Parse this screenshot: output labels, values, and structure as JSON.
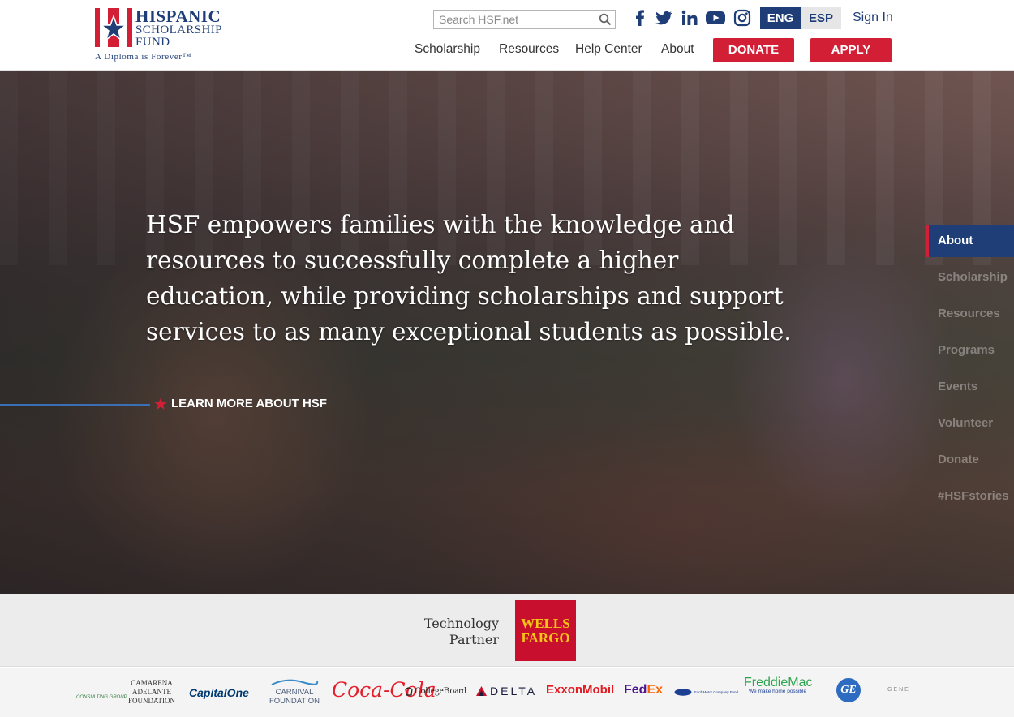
{
  "header": {
    "logo": {
      "line1": "HISPANIC",
      "line2": "SCHOLARSHIP",
      "line3": "FUND",
      "tagline": "A Diploma is Forever™"
    },
    "search": {
      "placeholder": "Search HSF.net",
      "value": ""
    },
    "social": [
      "facebook-icon",
      "twitter-icon",
      "linkedin-icon",
      "youtube-icon",
      "instagram-icon"
    ],
    "languages": {
      "active": "ENG",
      "other": "ESP"
    },
    "sign_in": "Sign In",
    "nav": [
      "Scholarship",
      "Resources",
      "Help Center",
      "About"
    ],
    "donate": "DONATE",
    "apply": "APPLY"
  },
  "hero": {
    "text": "HSF empowers families with the knowledge and resources to successfully complete a higher education, while providing scholarships and support services to as many exceptional students as possible.",
    "cta": "LEARN MORE ABOUT HSF",
    "side_nav": [
      "About",
      "Scholarship",
      "Resources",
      "Programs",
      "Events",
      "Volunteer",
      "Donate",
      "#HSFstories"
    ],
    "side_nav_active": "About"
  },
  "partner": {
    "label_line1": "Technology",
    "label_line2": "Partner",
    "logo_line1": "WELLS",
    "logo_line2": "FARGO"
  },
  "sponsors": {
    "consulting": "CONSULTING GROUP",
    "camarena1": "CAMARENA",
    "camarena2": "ADELANTE",
    "camarena3": "FOUNDATION",
    "capitalone": "CapitalOne",
    "carnival1": "CARNIVAL",
    "carnival2": "FOUNDATION",
    "cocacola": "Coca-Cola",
    "collegeboard": "CollegeBoard",
    "delta": "DELTA",
    "exxon": "ExxonMobil",
    "fedex1": "Fed",
    "fedex2": "Ex",
    "ford": "Ford Motor Company Fund",
    "freddie": "FreddieMac",
    "freddie_tag": "We make home possible",
    "ge": "GE",
    "gene": "GENE"
  },
  "colors": {
    "brand_blue": "#1f3e78",
    "brand_red": "#d31f36"
  }
}
